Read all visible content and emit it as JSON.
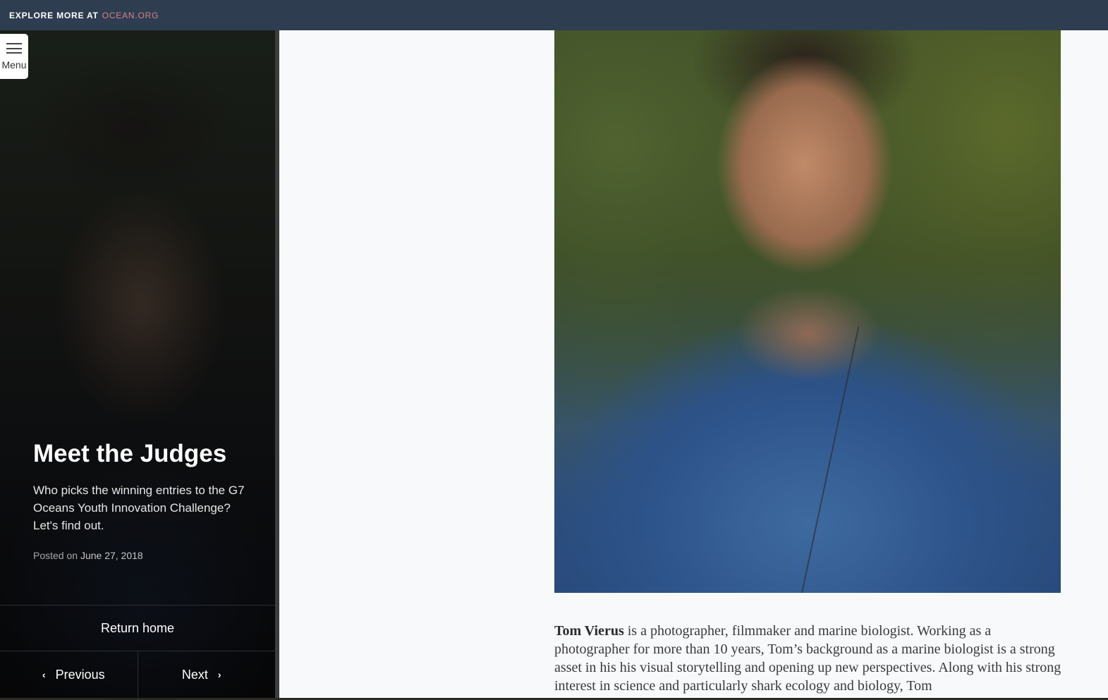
{
  "topbar": {
    "prefix": "EXPLORE MORE AT",
    "link": "OCEAN.ORG"
  },
  "menu": {
    "label": "Menu"
  },
  "sidebar": {
    "title": "Meet the Judges",
    "description": "Who picks the winning entries to the G7 Oceans Youth Innovation Challenge? Let's find out.",
    "posted_prefix": "Posted on",
    "posted_date": "June 27, 2018",
    "return_label": "Return home",
    "previous_label": "Previous",
    "next_label": "Next"
  },
  "article": {
    "bio_name": "Tom Vierus",
    "bio_text": " is a photographer, filmmaker and marine biologist. Working as a photographer for more than 10 years, Tom’s background as a marine biologist is a strong asset in his his visual storytelling and opening up new perspectives. Along with his strong interest in science and particularly shark ecology and biology, Tom"
  }
}
